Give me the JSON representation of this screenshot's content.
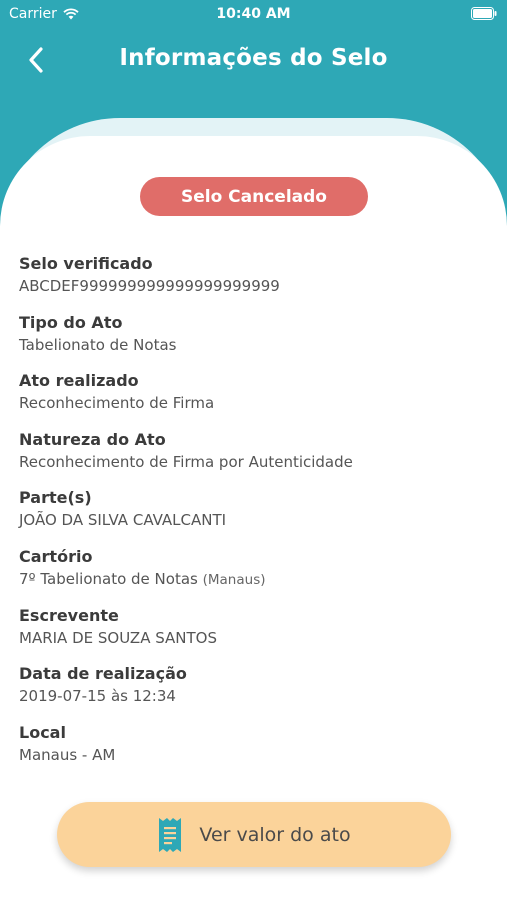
{
  "status_bar": {
    "carrier": "Carrier",
    "time": "10:40 AM"
  },
  "nav": {
    "title": "Informações do Selo"
  },
  "badge": {
    "label": "Selo Cancelado",
    "color": "#e06d69"
  },
  "details": [
    {
      "label": "Selo verificado",
      "value": "ABCDEF999999999999999999999"
    },
    {
      "label": "Tipo do Ato",
      "value": "Tabelionato de Notas"
    },
    {
      "label": "Ato realizado",
      "value": "Reconhecimento de Firma"
    },
    {
      "label": "Natureza do Ato",
      "value": "Reconhecimento de Firma por Autenticidade"
    },
    {
      "label": "Parte(s)",
      "value": "JOÃO DA SILVA CAVALCANTI"
    },
    {
      "label": "Cartório",
      "value": "7º Tabelionato de Notas",
      "note": "(Manaus)"
    },
    {
      "label": "Escrevente",
      "value": "MARIA DE SOUZA SANTOS"
    },
    {
      "label": "Data de realização",
      "value": "2019-07-15 às 12:34"
    },
    {
      "label": "Local",
      "value": "Manaus - AM"
    }
  ],
  "cta": {
    "label": "Ver valor do ato",
    "icon": "receipt-icon"
  },
  "colors": {
    "primary": "#2ea8b6",
    "cta": "#fbd39a",
    "icon": "#2ea8b6"
  }
}
